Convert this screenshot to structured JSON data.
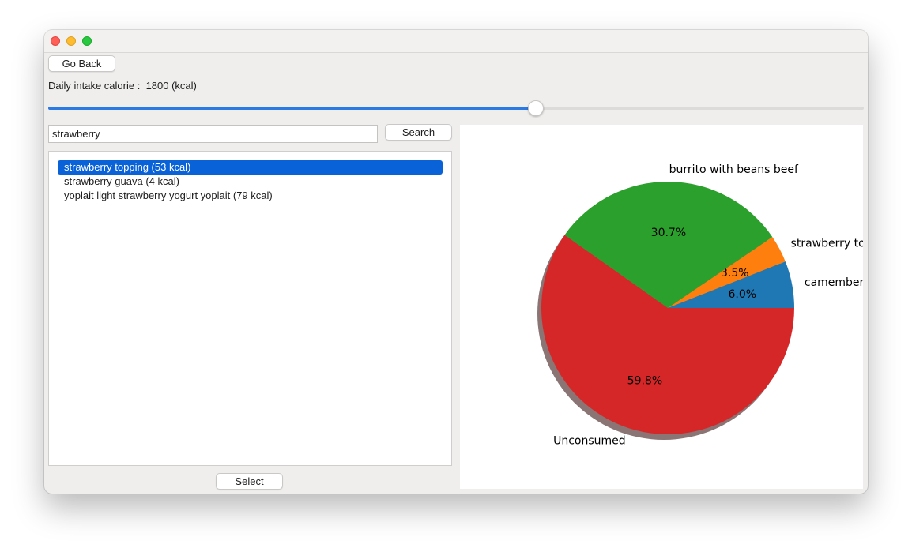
{
  "window": {
    "buttons": {
      "go_back": "Go Back",
      "search": "Search",
      "select": "Select"
    }
  },
  "intake": {
    "label": "Daily intake calorie :",
    "value": "1800 (kcal)"
  },
  "slider": {
    "fraction": 0.598
  },
  "search": {
    "value": "strawberry"
  },
  "results": [
    {
      "label": "strawberry topping (53 kcal)",
      "selected": true
    },
    {
      "label": "strawberry guava (4 kcal)",
      "selected": false
    },
    {
      "label": "yoplait light strawberry yogurt yoplait (79 kcal)",
      "selected": false
    }
  ],
  "chart_data": {
    "type": "pie",
    "shadow": true,
    "start_angle_deg": 0,
    "direction": "counterclockwise",
    "slices": [
      {
        "label": "camembert",
        "percent": 6.0,
        "pct_label": "6.0%",
        "color": "#1f77b4"
      },
      {
        "label": "strawberry topping",
        "percent": 3.5,
        "pct_label": "3.5%",
        "color": "#ff7f0e"
      },
      {
        "label": "burrito with beans beef",
        "percent": 30.7,
        "pct_label": "30.7%",
        "color": "#2ca02c"
      },
      {
        "label": "Unconsumed",
        "percent": 59.8,
        "pct_label": "59.8%",
        "color": "#d62728"
      }
    ]
  },
  "colors": {
    "accent": "#2b7ae4",
    "selection": "#0a62d8"
  }
}
